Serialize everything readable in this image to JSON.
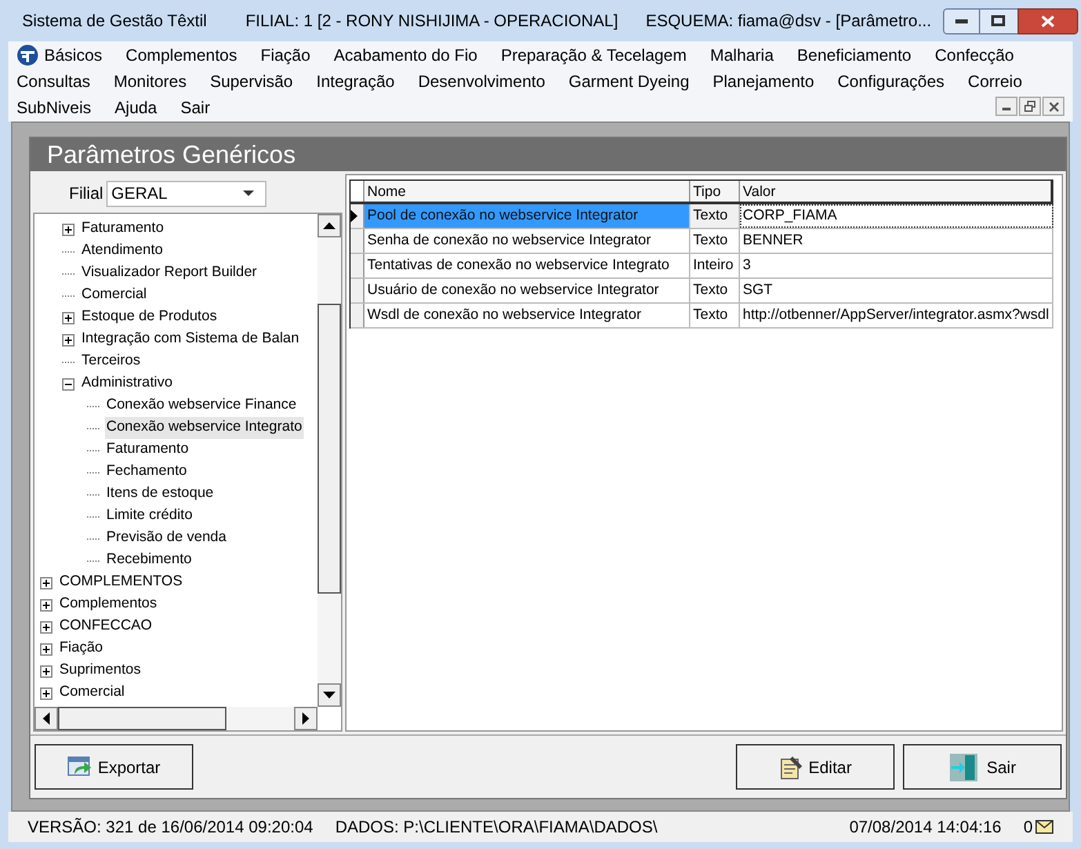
{
  "window": {
    "title": "Sistema de Gestão Têxtil",
    "filial": "FILIAL: 1 [2 - RONY NISHIJIMA - OPERACIONAL]",
    "schema": "ESQUEMA: fiama@dsv - [Parâmetro..."
  },
  "menu": [
    [
      "Básicos",
      "Complementos",
      "Fiação",
      "Acabamento do Fio",
      "Preparação & Tecelagem",
      "Malharia",
      "Beneficiamento",
      "Confecção"
    ],
    [
      "Consultas",
      "Monitores",
      "Supervisão",
      "Integração",
      "Desenvolvimento",
      "Garment Dyeing",
      "Planejamento",
      "Configurações",
      "Correio"
    ],
    [
      "SubNiveis",
      "Ajuda",
      "Sair"
    ]
  ],
  "form": {
    "title": "Parâmetros Genéricos",
    "filial_label": "Filial",
    "filial_value": "GERAL",
    "tree": {
      "continued_items": [
        {
          "label": "Faturamento",
          "kind": "folder",
          "expanded": false,
          "selected": false
        },
        {
          "label": "Atendimento",
          "kind": "leaf",
          "selected": false
        },
        {
          "label": "Visualizador Report Builder",
          "kind": "leaf",
          "selected": false
        },
        {
          "label": "Comercial",
          "kind": "leaf",
          "selected": false
        },
        {
          "label": "Estoque de Produtos",
          "kind": "folder",
          "expanded": false,
          "selected": false
        },
        {
          "label": "Integração com Sistema de Balan",
          "kind": "folder",
          "expanded": false,
          "selected": false
        },
        {
          "label": "Terceiros",
          "kind": "leaf",
          "selected": false
        },
        {
          "label": "Administrativo",
          "kind": "folder",
          "expanded": true,
          "selected": false,
          "children": [
            {
              "label": "Conexão webservice Finance",
              "kind": "leaf",
              "selected": false
            },
            {
              "label": "Conexão webservice Integrato",
              "kind": "leaf",
              "selected": true
            },
            {
              "label": "Faturamento",
              "kind": "leaf",
              "selected": false
            },
            {
              "label": "Fechamento",
              "kind": "leaf",
              "selected": false
            },
            {
              "label": "Itens de estoque",
              "kind": "leaf",
              "selected": false
            },
            {
              "label": "Limite crédito",
              "kind": "leaf",
              "selected": false
            },
            {
              "label": "Previsão de venda",
              "kind": "leaf",
              "selected": false
            },
            {
              "label": "Recebimento",
              "kind": "leaf",
              "selected": false
            }
          ]
        }
      ],
      "items": [
        {
          "label": "COMPLEMENTOS",
          "kind": "folder",
          "expanded": false,
          "selected": false
        },
        {
          "label": "Complementos",
          "kind": "folder",
          "expanded": false,
          "selected": false
        },
        {
          "label": "CONFECCAO",
          "kind": "folder",
          "expanded": false,
          "selected": false
        },
        {
          "label": "Fiação",
          "kind": "folder",
          "expanded": false,
          "selected": false
        },
        {
          "label": "Suprimentos",
          "kind": "folder",
          "expanded": false,
          "selected": false
        },
        {
          "label": "Comercial",
          "kind": "folder",
          "expanded": false,
          "selected": false
        }
      ]
    },
    "table": {
      "columns": [
        "Nome",
        "Tipo",
        "Valor"
      ],
      "rows": [
        {
          "cells": [
            "Pool de conexão no webservice Integrator",
            "Texto",
            "CORP_FIAMA"
          ],
          "selected": true
        },
        {
          "cells": [
            "Senha de conexão no webservice Integrator",
            "Texto",
            "BENNER"
          ],
          "selected": false
        },
        {
          "cells": [
            "Tentativas de conexão no webservice Integrato",
            "Inteiro",
            "3"
          ],
          "selected": false
        },
        {
          "cells": [
            "Usuário de conexão no webservice Integrator",
            "Texto",
            "SGT"
          ],
          "selected": false
        },
        {
          "cells": [
            "Wsdl de conexão no webservice Integrator",
            "Texto",
            "http://otbenner/AppServer/integrator.asmx?wsdl"
          ],
          "selected": false
        }
      ]
    },
    "buttons": {
      "export": "Exportar",
      "edit": "Editar",
      "exit": "Sair"
    }
  },
  "status_bar": {
    "version": "VERSÃO: 321 de 16/06/2014 09:20:04",
    "data": "DADOS: P:\\CLIENTE\\ORA\\FIAMA\\DADOS\\",
    "datetime": "07/08/2014 14:04:16",
    "messages": "0"
  }
}
